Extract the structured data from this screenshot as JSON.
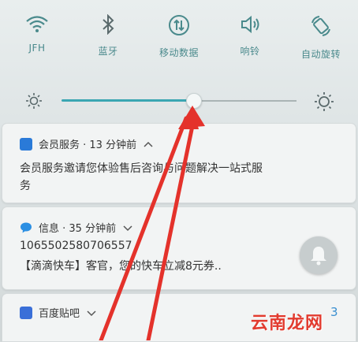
{
  "quick_settings": {
    "tiles": [
      {
        "label": "JFH",
        "icon": "wifi-icon"
      },
      {
        "label": "蓝牙",
        "icon": "bluetooth-icon"
      },
      {
        "label": "移动数据",
        "icon": "mobile-data-icon"
      },
      {
        "label": "响铃",
        "icon": "volume-icon"
      },
      {
        "label": "自动旋转",
        "icon": "auto-rotate-icon"
      }
    ],
    "brightness_level": 0.57,
    "accent_color": "#3aa6b2"
  },
  "notifications": [
    {
      "app": "会员服务",
      "meta": " · 13 分钟前",
      "body_line1": "会员服务邀请您体验售后咨询与问题解决一站式服",
      "body_line2": "务",
      "icon": "member-service-icon",
      "icon_color": "#2a7ad8"
    },
    {
      "app": "信息",
      "meta": " · 35 分钟前",
      "sender": "10655025807065",
      "sender_tail": "57",
      "body_line1": "【滴滴快车】客官，您的快车立减8元券..",
      "icon": "message-icon",
      "icon_color": "#2b8fe3"
    },
    {
      "app": "百度贴吧",
      "meta": "",
      "count": "3",
      "icon": "tieba-icon",
      "icon_color": "#3a6fd8"
    }
  ],
  "watermark": "云南龙网",
  "arrow_color": "#e4322b"
}
